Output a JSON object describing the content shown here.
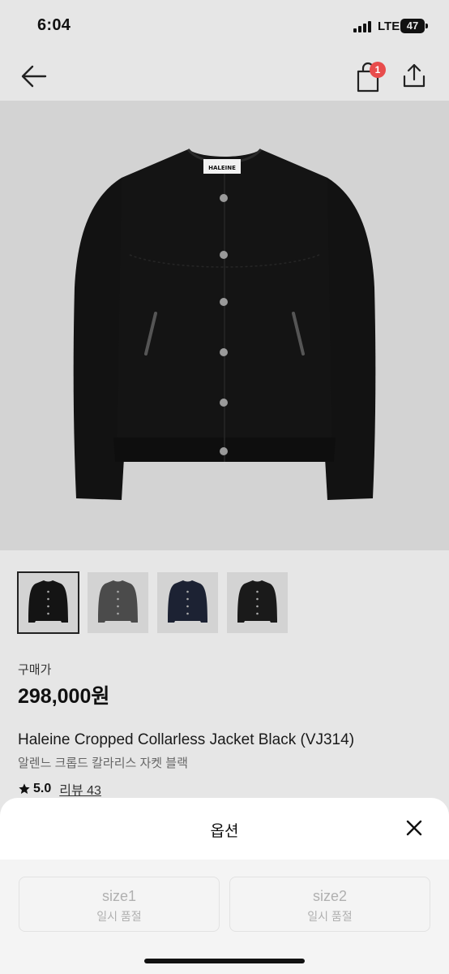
{
  "status_bar": {
    "time": "6:04",
    "network": "LTE",
    "battery": "47"
  },
  "nav": {
    "cart_count": "1",
    "icons": [
      "arrow-left-icon",
      "shopping-bag-icon",
      "share-icon"
    ]
  },
  "product": {
    "image_brand_label": "HALEINE",
    "thumbnails": [
      {
        "color": "#141414",
        "selected": true
      },
      {
        "color": "#4b4b4b",
        "selected": false
      },
      {
        "color": "#1c2233",
        "selected": false
      },
      {
        "color": "#1a1a1a",
        "selected": false
      }
    ],
    "price_label": "구매가",
    "price": "298,000원",
    "title_en": "Haleine Cropped Collarless Jacket Black (VJ314)",
    "title_ko": "알렌느 크롭드 칼라리스 자켓 블랙",
    "rating": "5.0",
    "review_label": "리뷰 43"
  },
  "sheet": {
    "title": "옵션",
    "options": [
      {
        "name": "size1",
        "status": "일시 품절"
      },
      {
        "name": "size2",
        "status": "일시 품절"
      }
    ]
  },
  "colors": {
    "background": "#e6e6e6",
    "badge": "#e84c4c",
    "disabled_text": "#b0b0b0"
  }
}
